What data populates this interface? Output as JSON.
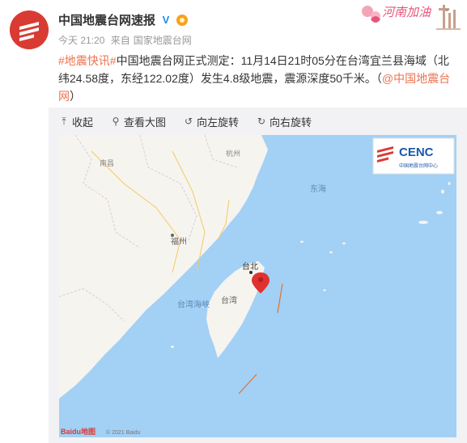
{
  "post": {
    "author": "中国地震台网速报",
    "time": "今天 21:20",
    "source_prefix": "来自",
    "source": "国家地震台网",
    "hashtag": "#地震快讯#",
    "body": "中国地震台网正式测定：11月14日21时05分在台湾宜兰县海域（北纬24.58度，东经122.02度）发生4.8级地震，震源深度50千米。（",
    "mention": "@中国地震台网",
    "body_end": "）"
  },
  "banner": {
    "text": "河南加油"
  },
  "media_toolbar": {
    "collapse": "收起",
    "view_large": "查看大图",
    "rotate_left": "向左旋转",
    "rotate_right": "向右旋转"
  },
  "map": {
    "logo_text": "CENC",
    "logo_subtitle": "中国地震台网中心",
    "baidu_text": "Baidu地图",
    "copyright": "© 2021 Baidu",
    "labels": {
      "taipei": "台北",
      "taiwan": "台湾",
      "fuzhou": "福州",
      "taiwan_strait": "台湾海峡",
      "east_sea": "东海",
      "nanchang": "南昌",
      "hangzhou": "杭州"
    }
  },
  "colors": {
    "accent": "#eb7350",
    "sea": "#a3d0f5",
    "land": "#f6f4ee",
    "epicenter": "#e0322f",
    "brand_red": "#d93b33",
    "cenc_blue": "#1a58a8"
  },
  "icons": {
    "verified": "verified-icon",
    "medal": "medal-icon",
    "collapse": "collapse-icon",
    "search": "search-icon",
    "rotate_left": "rotate-left-icon",
    "rotate_right": "rotate-right-icon",
    "chevron": "chevron-down-icon",
    "pin": "map-pin-icon"
  }
}
